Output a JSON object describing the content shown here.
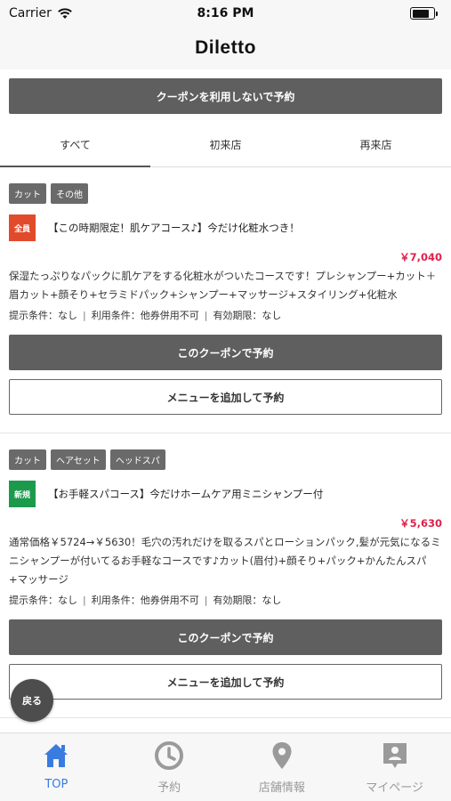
{
  "status_bar": {
    "carrier": "Carrier",
    "time": "8:16 PM"
  },
  "nav": {
    "title": "Diletto"
  },
  "no_coupon_button": "クーポンを利用しないで予約",
  "tabs": [
    {
      "label": "すべて"
    },
    {
      "label": "初来店"
    },
    {
      "label": "再来店"
    }
  ],
  "coupons": [
    {
      "tags": [
        "カット",
        "その他"
      ],
      "badge": "全員",
      "badge_color": "#e24a2c",
      "title": "【この時期限定！肌ケアコース♪】今だけ化粧水つき！",
      "price": "￥7,040",
      "description": "保湿たっぷりなパックに肌ケアをする化粧水がついたコースです！プレシャンプー+カット＋眉カット+顔そり+セラミドパック+シャンプー+マッサージ+スタイリング+化粧水",
      "conditions": {
        "present": "提示条件：なし",
        "usage": "利用条件：他券併用不可",
        "expiry": "有効期限：なし"
      },
      "reserve_button": "このクーポンで予約",
      "add_menu_button": "メニューを追加して予約"
    },
    {
      "tags": [
        "カット",
        "ヘアセット",
        "ヘッドスパ"
      ],
      "badge": "新規",
      "badge_color": "#1c9a4c",
      "title": "【お手軽スパコース】今だけホームケア用ミニシャンプー付",
      "price": "￥5,630",
      "description": "通常価格￥5724→￥5630！毛穴の汚れだけを取るスパとローションパック,髪が元気になるミニシャンプーが付いてるお手軽なコースです♪カット(眉付)+顔そり+パック+かんたんスパ+マッサージ",
      "conditions": {
        "present": "提示条件：なし",
        "usage": "利用条件：他券併用不可",
        "expiry": "有効期限：なし"
      },
      "reserve_button": "このクーポンで予約",
      "add_menu_button": "メニューを追加して予約"
    }
  ],
  "back_button": "戻る",
  "tab_bar": [
    {
      "label": "TOP",
      "icon": "home-icon",
      "active": true
    },
    {
      "label": "予約",
      "icon": "clock-icon",
      "active": false
    },
    {
      "label": "店舗情報",
      "icon": "map-pin-icon",
      "active": false
    },
    {
      "label": "マイページ",
      "icon": "user-badge-icon",
      "active": false
    }
  ],
  "colors": {
    "accent": "#3a7be0",
    "price": "#e0204a",
    "button_dark": "#5f5f5f"
  }
}
